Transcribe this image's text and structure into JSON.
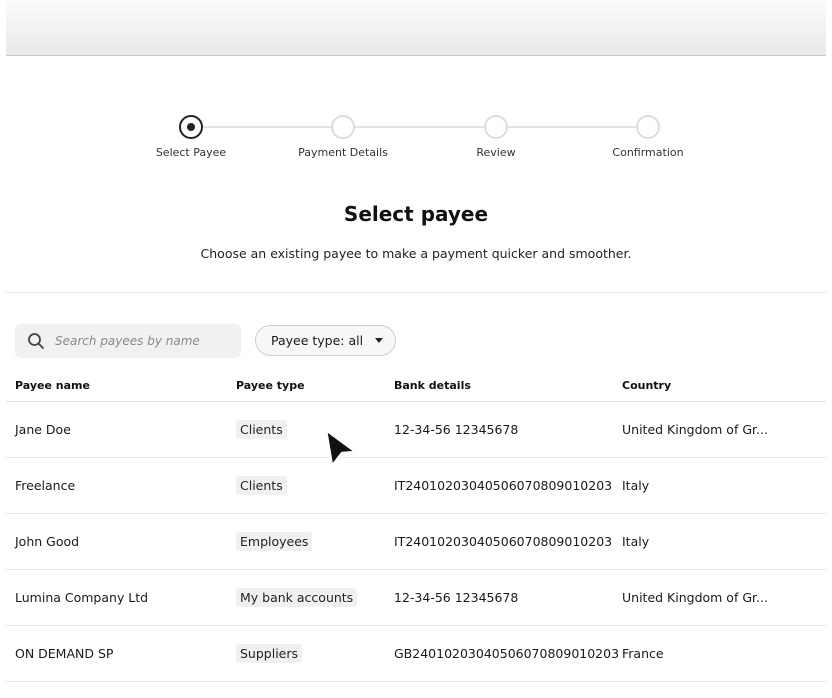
{
  "stepper": {
    "steps": [
      {
        "label": "Select Payee",
        "active": true
      },
      {
        "label": "Payment Details",
        "active": false
      },
      {
        "label": "Review",
        "active": false
      },
      {
        "label": "Confirmation",
        "active": false
      }
    ]
  },
  "page": {
    "title": "Select payee",
    "subtitle": "Choose an existing payee to make a payment quicker and smoother."
  },
  "search": {
    "placeholder": "Search payees by name",
    "icon": "search-icon"
  },
  "filter": {
    "label": "Payee type: all",
    "icon": "caret-down-icon"
  },
  "table": {
    "headers": [
      "Payee name",
      "Payee type",
      "Bank details",
      "Country"
    ],
    "rows": [
      {
        "name": "Jane Doe",
        "type": "Clients",
        "bank": "12-34-56 12345678",
        "country": "United Kingdom of Gr..."
      },
      {
        "name": "Freelance",
        "type": "Clients",
        "bank": "IT24010203040506070809010203",
        "country": "Italy"
      },
      {
        "name": "John Good",
        "type": "Employees",
        "bank": "IT24010203040506070809010203",
        "country": "Italy"
      },
      {
        "name": "Lumina Company Ltd",
        "type": "My bank accounts",
        "bank": "12-34-56 12345678",
        "country": "United Kingdom of Gr..."
      },
      {
        "name": "ON DEMAND SP",
        "type": "Suppliers",
        "bank": "GB24010203040506070809010203",
        "country": "France"
      }
    ]
  },
  "colors": {
    "accent": "#222222",
    "step_inactive": "#dcdcdc",
    "badge_bg": "#f0f0f0"
  }
}
